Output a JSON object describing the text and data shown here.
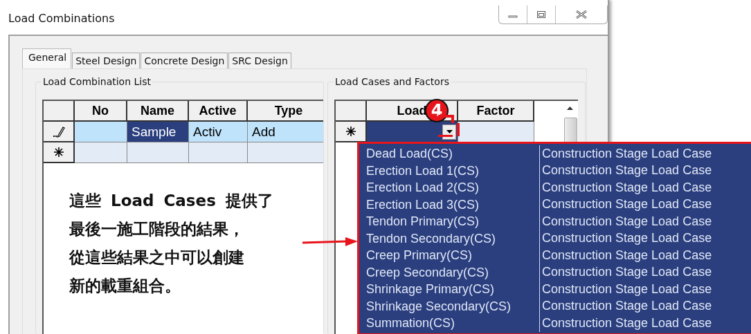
{
  "window": {
    "title": "Load Combinations"
  },
  "tabs": [
    {
      "label": "General",
      "selected": true
    },
    {
      "label": "Steel Design",
      "selected": false
    },
    {
      "label": "Concrete Design",
      "selected": false
    },
    {
      "label": "SRC Design",
      "selected": false
    }
  ],
  "combination_list": {
    "title": "Load Combination List",
    "columns": [
      "No",
      "Name",
      "Active",
      "Type"
    ],
    "rows": [
      {
        "kind": "editing",
        "cells": [
          {
            "text": "",
            "selected": false
          },
          {
            "text": "Sample",
            "selected": true
          },
          {
            "text": "Activ",
            "selected": false
          },
          {
            "text": "Add",
            "selected": false
          }
        ]
      },
      {
        "kind": "new",
        "cells": [
          {
            "text": "",
            "selected": false
          },
          {
            "text": "",
            "selected": false
          },
          {
            "text": "",
            "selected": false
          },
          {
            "text": "",
            "selected": false
          }
        ]
      }
    ]
  },
  "cases_and_factors": {
    "title": "Load Cases and Factors",
    "columns": [
      "Load",
      "Factor"
    ],
    "rows": [
      {
        "kind": "new",
        "cells": [
          {
            "text": "",
            "selected": true,
            "dropdown": true
          },
          {
            "text": "",
            "selected": false,
            "dropdown": false
          }
        ]
      }
    ]
  },
  "dropdown": {
    "items": [
      {
        "name": "Dead Load(CS)",
        "type": "Construction Stage Load Case"
      },
      {
        "name": "Erection Load 1(CS)",
        "type": "Construction Stage Load Case"
      },
      {
        "name": "Erection Load 2(CS)",
        "type": "Construction Stage Load Case"
      },
      {
        "name": "Erection Load 3(CS)",
        "type": "Construction Stage Load Case"
      },
      {
        "name": "Tendon Primary(CS)",
        "type": "Construction Stage Load Case"
      },
      {
        "name": "Tendon Secondary(CS)",
        "type": "Construction Stage Load Case"
      },
      {
        "name": "Creep Primary(CS)",
        "type": "Construction Stage Load Case"
      },
      {
        "name": "Creep Secondary(CS)",
        "type": "Construction Stage Load Case"
      },
      {
        "name": "Shrinkage Primary(CS)",
        "type": "Construction Stage Load Case"
      },
      {
        "name": "Shrinkage Secondary(CS)",
        "type": "Construction Stage Load Case"
      },
      {
        "name": "Summation(CS)",
        "type": "Construction Stage Load Case"
      }
    ]
  },
  "annotation": {
    "step": "4",
    "lines": [
      "這些 Load Cases 提供了",
      "最後一施工階段的結果，",
      "從這些結果之中可以創建",
      "新的載重組合。"
    ]
  }
}
